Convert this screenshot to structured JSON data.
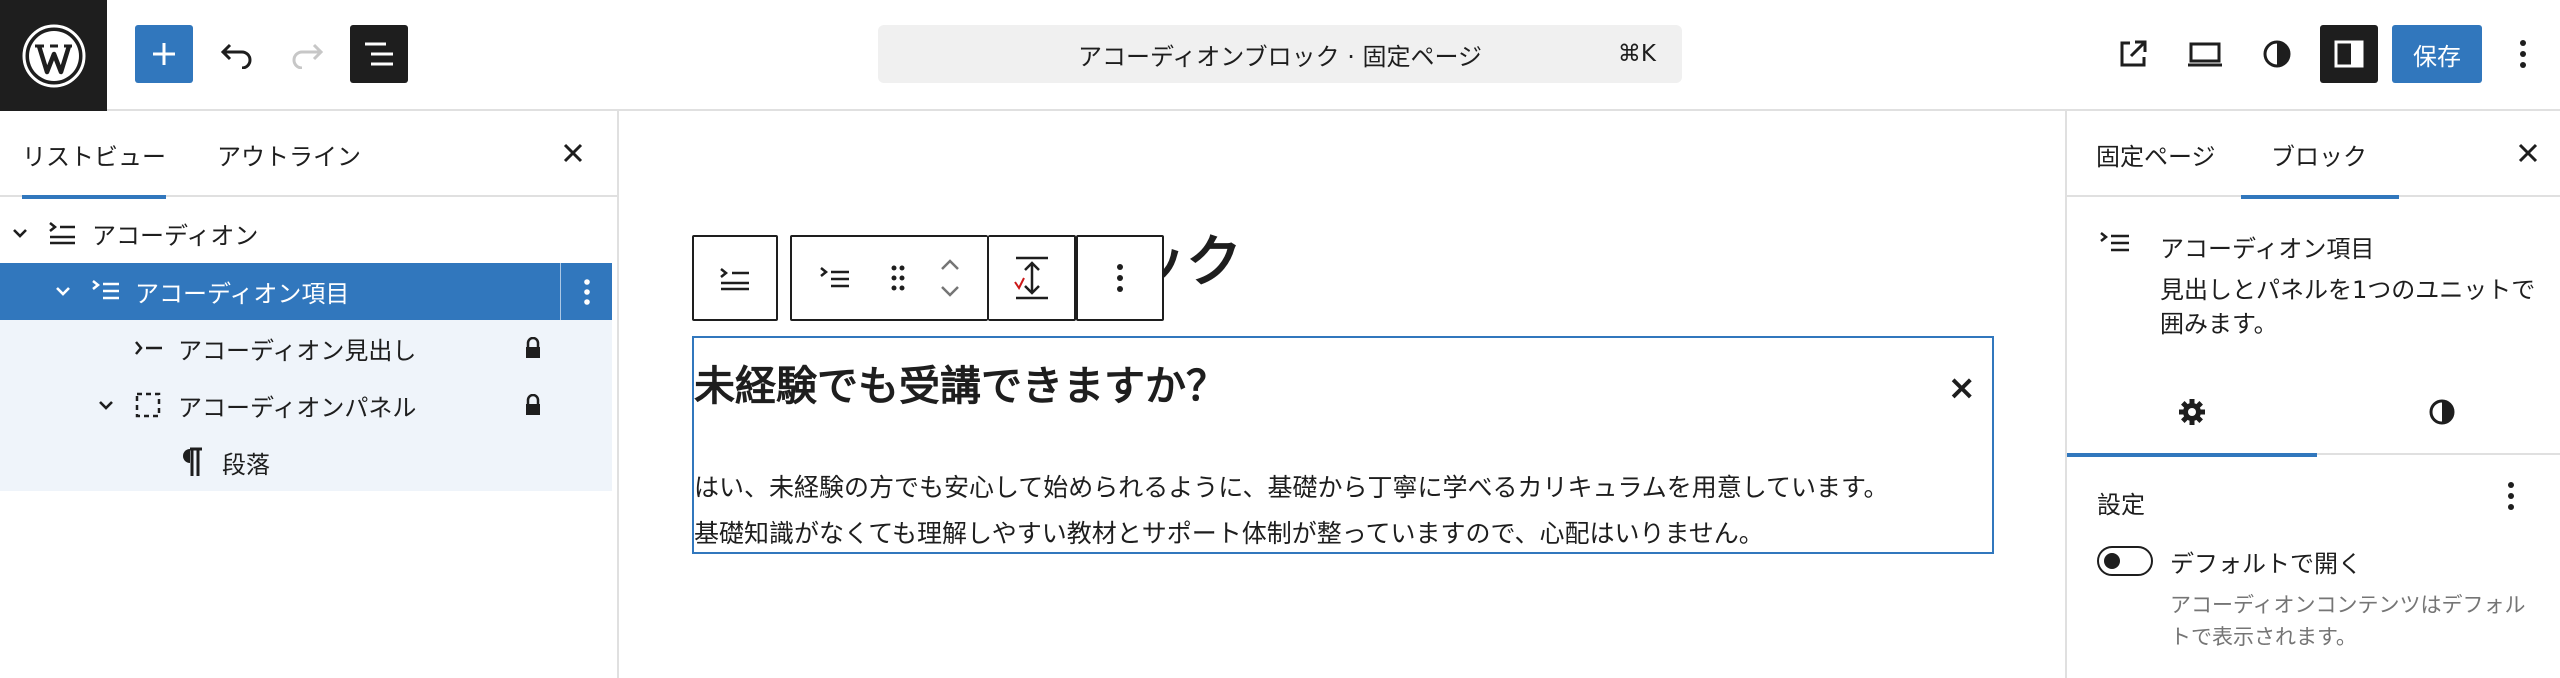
{
  "header": {
    "logo": "wordpress-logo",
    "add_label": "+",
    "command_title": "アコーディオンブロック · 固定ページ",
    "command_shortcut": "⌘K",
    "save_label": "保存"
  },
  "list_view": {
    "tabs": [
      "リストビュー",
      "アウトライン"
    ],
    "active_tab": 0,
    "rows": [
      {
        "label": "アコーディオン",
        "icon": "accordion-icon"
      },
      {
        "label": "アコーディオン項目",
        "icon": "accordion-item-icon"
      },
      {
        "label": "アコーディオン見出し",
        "icon": "accordion-heading-icon"
      },
      {
        "label": "アコーディオンパネル",
        "icon": "accordion-panel-icon"
      },
      {
        "label": "段落",
        "icon": "paragraph-icon"
      }
    ]
  },
  "canvas": {
    "page_title": "ック",
    "accordion_heading": "未経験でも受講できますか？",
    "accordion_toggle": "×",
    "paragraph_line1": "はい、未経験の方でも安心して始められるように、基礎から丁寧に学べるカリキュラムを用意しています。",
    "paragraph_line2": "基礎知識がなくても理解しやすい教材とサポート体制が整っていますので、心配はいりません。"
  },
  "sidebar": {
    "tabs": [
      "固定ページ",
      "ブロック"
    ],
    "active_tab": 1,
    "block_title": "アコーディオン項目",
    "block_description": "見出しとパネルを1つのユニットで囲みます。",
    "settings_heading": "設定",
    "toggle_label": "デフォルトで開く",
    "toggle_on": false,
    "toggle_help": "アコーディオンコンテンツはデフォルトで表示されます。"
  },
  "colors": {
    "accent": "#3177bd",
    "dark": "#1e1e1e",
    "muted": "#757575"
  }
}
